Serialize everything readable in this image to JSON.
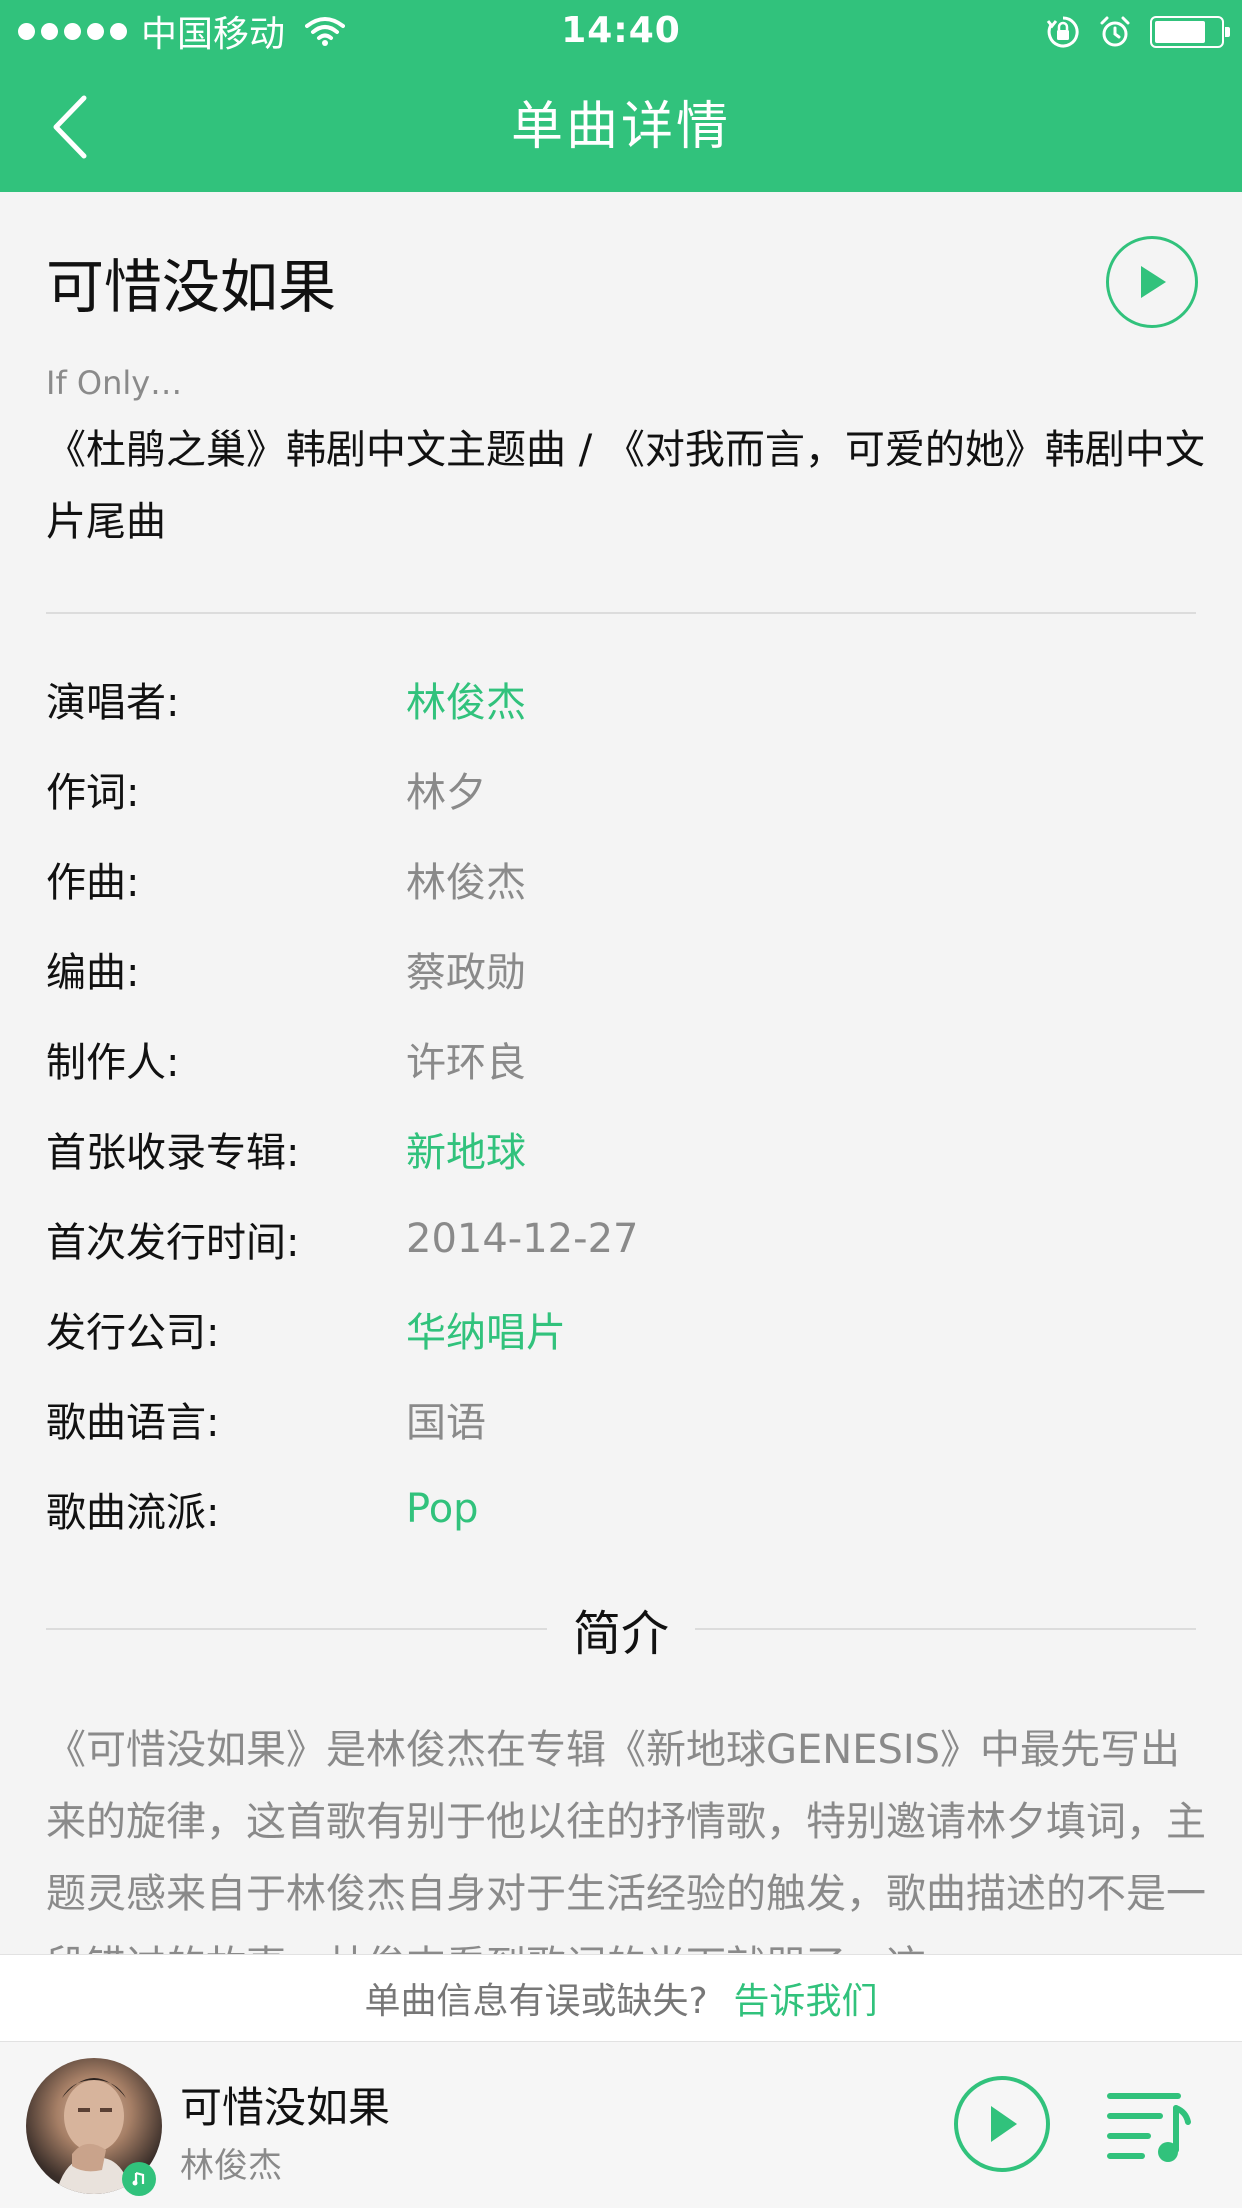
{
  "statusbar": {
    "carrier": "中国移动",
    "time": "14:40",
    "battery_level": 0.8
  },
  "navbar": {
    "title": "单曲详情"
  },
  "song": {
    "title": "可惜没如果",
    "alt_title": "If Only…",
    "subtitle": "《杜鹃之巢》韩剧中文主题曲 / 《对我而言，可爱的她》韩剧中文片尾曲"
  },
  "info": [
    {
      "label": "演唱者:",
      "value": "林俊杰",
      "link": true
    },
    {
      "label": "作词:",
      "value": "林夕",
      "link": false
    },
    {
      "label": "作曲:",
      "value": "林俊杰",
      "link": false
    },
    {
      "label": "编曲:",
      "value": "蔡政勋",
      "link": false
    },
    {
      "label": "制作人:",
      "value": "许环良",
      "link": false
    },
    {
      "label": "首张收录专辑:",
      "value": "新地球",
      "link": true
    },
    {
      "label": "首次发行时间:",
      "value": "2014-12-27",
      "link": false
    },
    {
      "label": "发行公司:",
      "value": "华纳唱片",
      "link": true
    },
    {
      "label": "歌曲语言:",
      "value": "国语",
      "link": false
    },
    {
      "label": "歌曲流派:",
      "value": "Pop",
      "link": true
    }
  ],
  "intro": {
    "heading": "简介",
    "text": "《可惜没如果》是林俊杰在专辑《新地球GENESIS》中最先写出来的旋律，这首歌有别于他以往的抒情歌，特别邀请林夕填词，主题灵感来自于林俊杰自身对于生活经验的触发，歌曲描述的不是一段错过的故事，林俊杰看到歌词的当下就哭了，这"
  },
  "report": {
    "text": "单曲信息有误或缺失?",
    "link": "告诉我们"
  },
  "player": {
    "title": "可惜没如果",
    "artist": "林俊杰"
  },
  "colors": {
    "accent": "#31c27c",
    "muted_text": "#8a8a8a"
  }
}
